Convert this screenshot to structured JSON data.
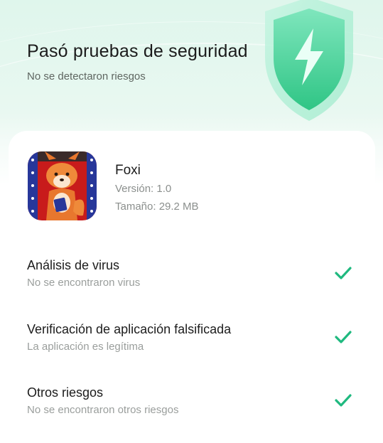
{
  "header": {
    "title": "Pasó pruebas de seguridad",
    "subtitle": "No se detectaron riesgos",
    "shield_icon": "shield-lightning-icon"
  },
  "app": {
    "name": "Foxi",
    "version": "Versión: 1.0",
    "size": "Tamaño: 29.2 MB",
    "icon": "fox-app-icon"
  },
  "checks": [
    {
      "title": "Análisis de virus",
      "subtitle": "No se encontraron virus",
      "status_icon": "check-icon"
    },
    {
      "title": "Verificación de aplicación falsificada",
      "subtitle": "La aplicación es legítima",
      "status_icon": "check-icon"
    },
    {
      "title": "Otros riesgos",
      "subtitle": "No se encontraron otros riesgos",
      "status_icon": "check-icon"
    }
  ],
  "colors": {
    "accent": "#1fb97f",
    "header_bg": "#dff6ec",
    "shield": "#3fd49a"
  }
}
